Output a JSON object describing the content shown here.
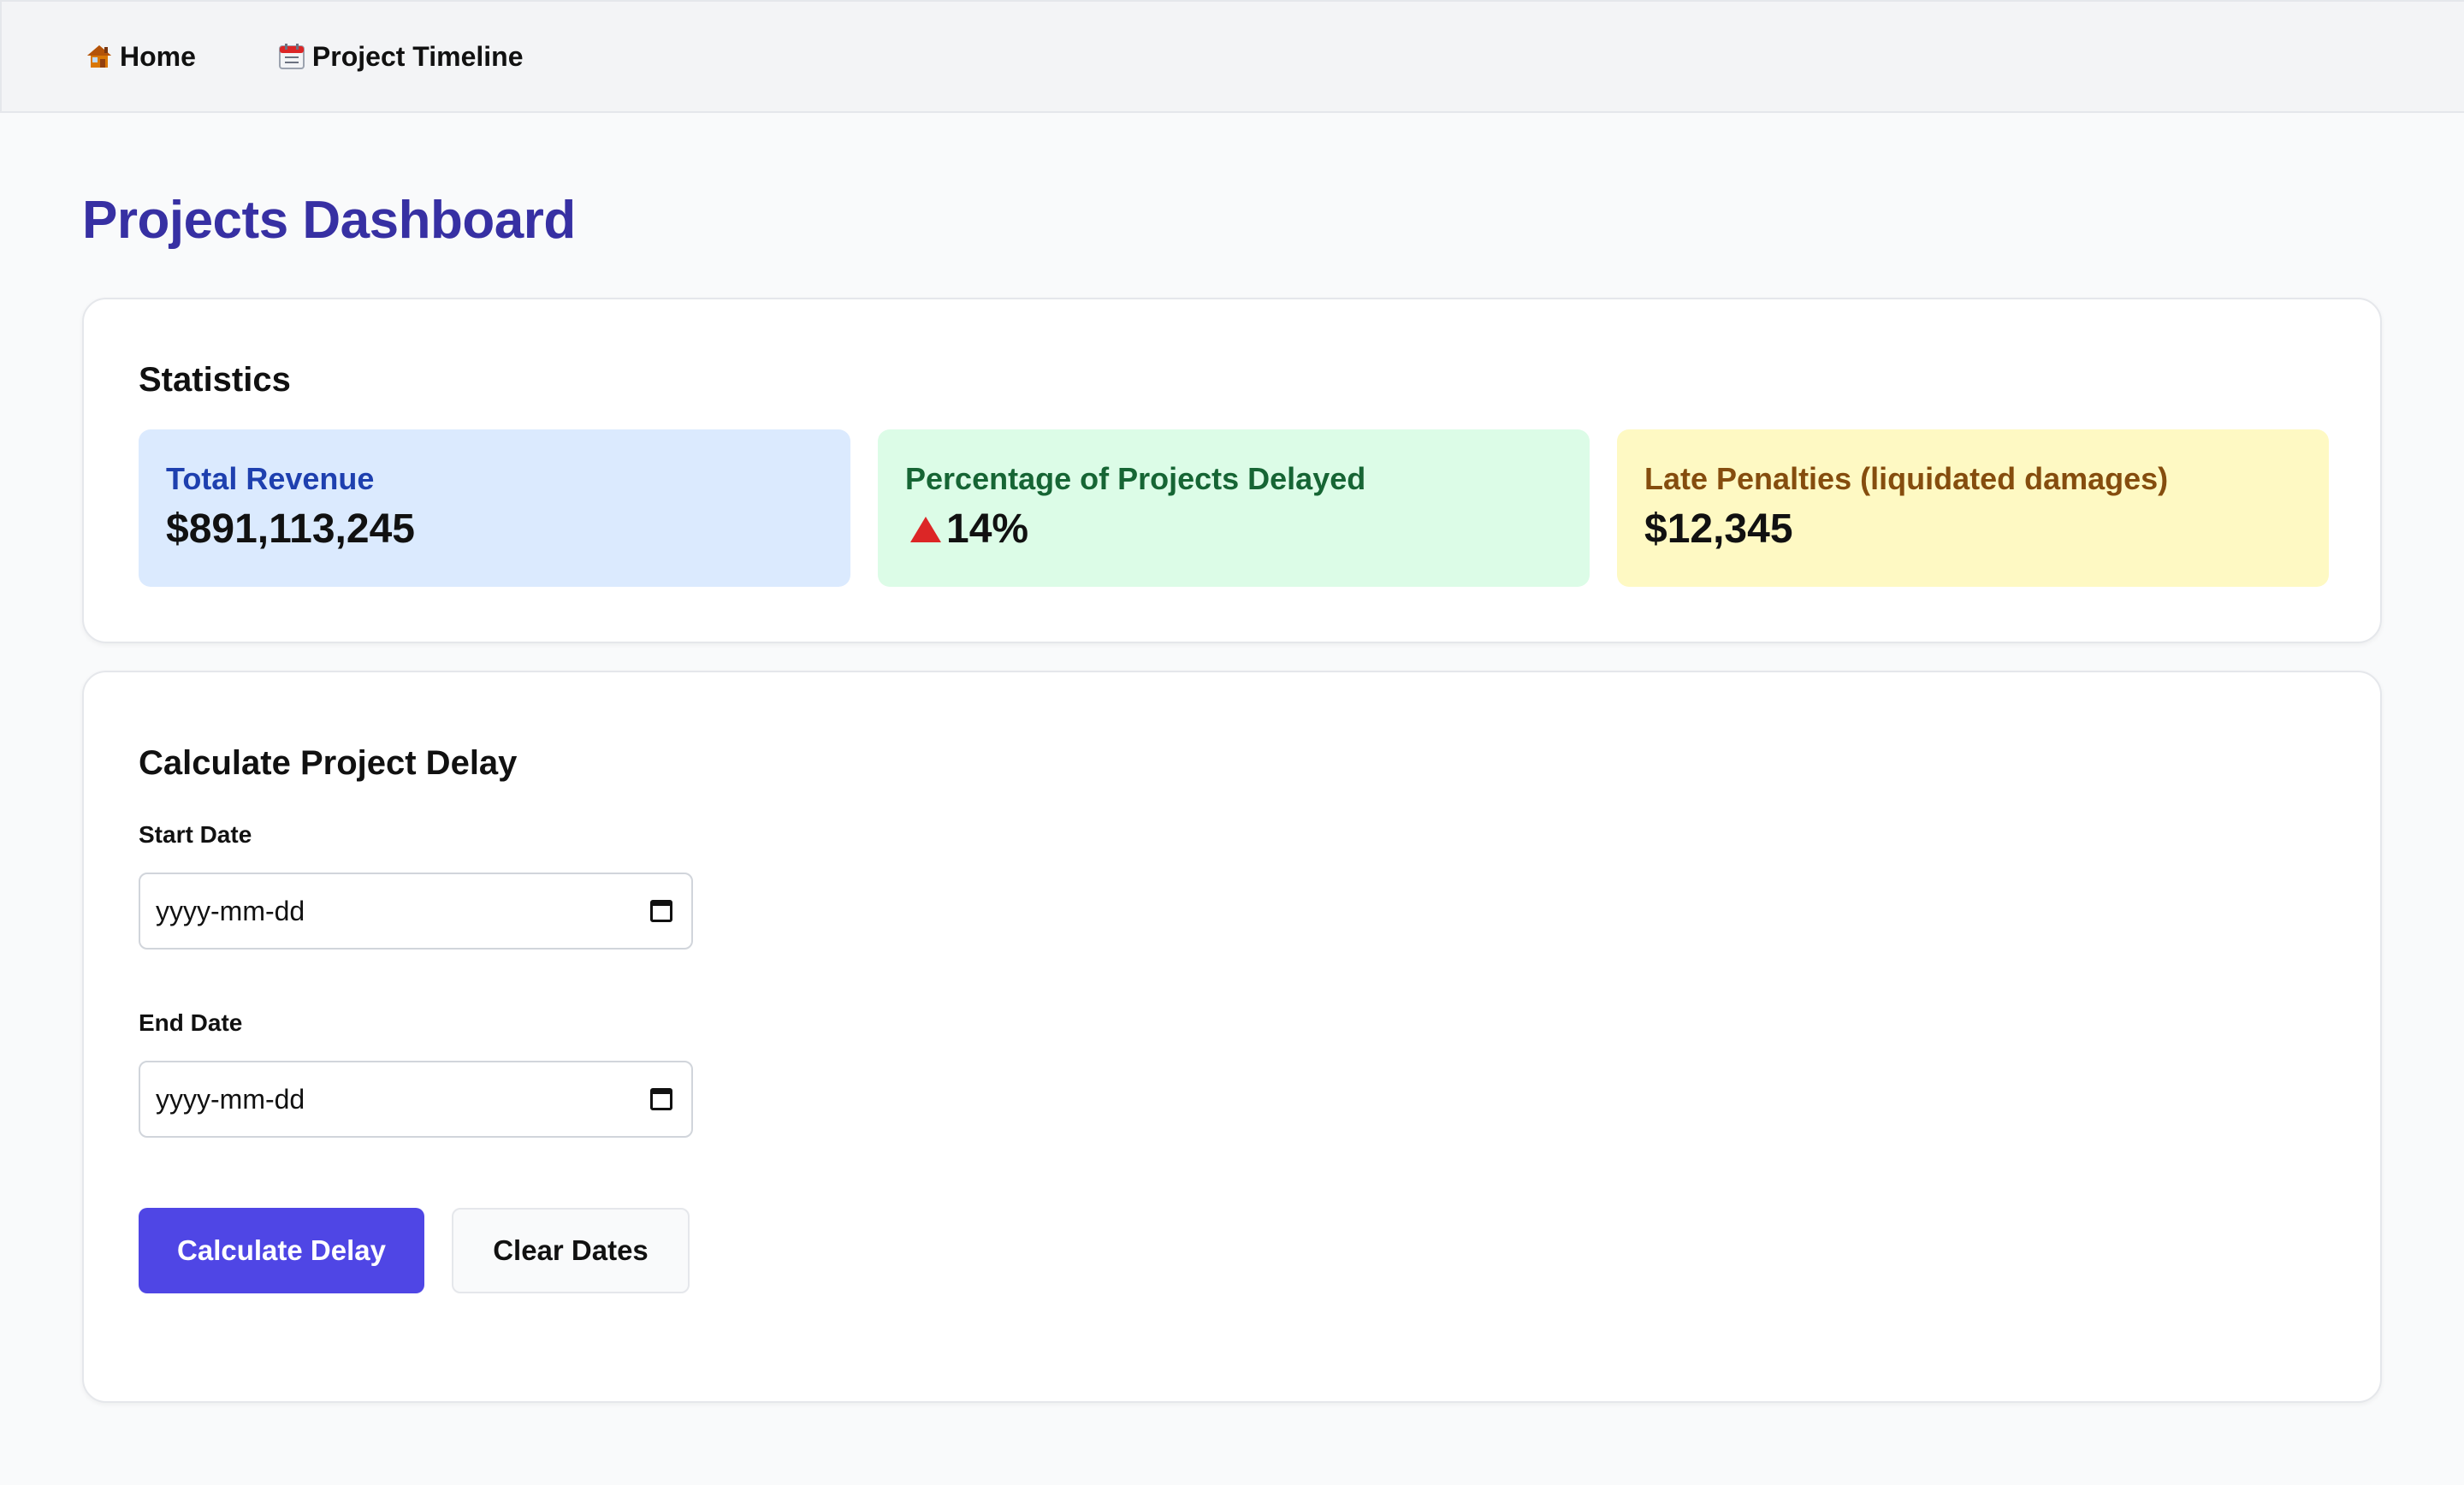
{
  "nav": {
    "items": [
      {
        "label": "Home",
        "icon": "house-icon"
      },
      {
        "label": "Project Timeline",
        "icon": "calendar-icon"
      }
    ]
  },
  "page": {
    "title": "Projects Dashboard"
  },
  "statistics": {
    "heading": "Statistics",
    "tiles": [
      {
        "label": "Total Revenue",
        "value": "$891,113,245",
        "color": "#1e40af",
        "bg": "#dbeafe"
      },
      {
        "label": "Percentage of Projects Delayed",
        "value": "14%",
        "indicator": "triangle-up-icon",
        "color": "#166534",
        "bg": "#dcfce7"
      },
      {
        "label": "Late Penalties (liquidated damages)",
        "value": "$12,345",
        "color": "#854d0e",
        "bg": "#fef9c3"
      }
    ]
  },
  "delay_form": {
    "heading": "Calculate Project Delay",
    "start_date": {
      "label": "Start Date",
      "value": "",
      "placeholder": "yyyy-mm-dd"
    },
    "end_date": {
      "label": "End Date",
      "value": "",
      "placeholder": "yyyy-mm-dd"
    },
    "calculate_label": "Calculate Delay",
    "clear_label": "Clear Dates"
  },
  "colors": {
    "accent": "#4f46e5",
    "title": "#3730a3",
    "delay_indicator": "#dc2626"
  }
}
